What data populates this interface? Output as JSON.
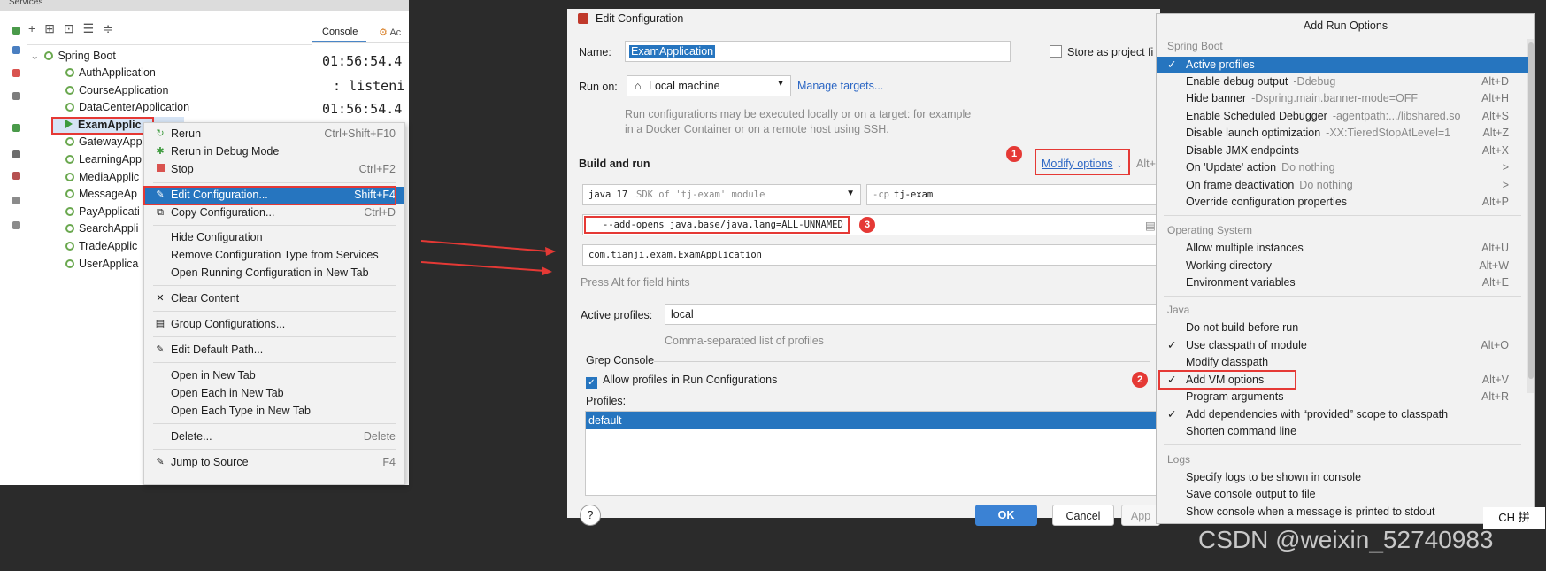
{
  "services": {
    "top_title": "Services",
    "toolbar_icons": [
      "add-icon",
      "group-icon",
      "new-tab-icon",
      "expand-all-icon",
      "collapse-all-icon"
    ],
    "tree_root": "Spring Boot",
    "apps": [
      "AuthApplication",
      "CourseApplication",
      "DataCenterApplication",
      "ExamApplic",
      "GatewayApp",
      "LearningApp",
      "MediaApplic",
      "MessageAp",
      "PayApplicati",
      "SearchAppli",
      "TradeApplic",
      "UserApplica"
    ],
    "console_tab": "Console",
    "console_tab2": "Ac",
    "console_lines": [
      "01:56:54.4",
      ": listeni",
      "01:56:54.4"
    ]
  },
  "context_menu": {
    "items": [
      {
        "label": "Rerun",
        "shortcut": "Ctrl+Shift+F10",
        "icon": "rerun-icon"
      },
      {
        "label": "Rerun in Debug Mode",
        "shortcut": "",
        "icon": "debug-icon"
      },
      {
        "label": "Stop",
        "shortcut": "Ctrl+F2",
        "icon": "stop-icon"
      },
      {
        "label": "Edit Configuration...",
        "shortcut": "Shift+F4",
        "icon": "edit-icon"
      },
      {
        "label": "Copy Configuration...",
        "shortcut": "Ctrl+D",
        "icon": "copy-icon"
      },
      {
        "label": "Hide Configuration",
        "shortcut": ""
      },
      {
        "label": "Remove Configuration Type from Services",
        "shortcut": ""
      },
      {
        "label": "Open Running Configuration in New Tab",
        "shortcut": ""
      },
      {
        "label": "Clear Content",
        "shortcut": "",
        "icon": "close-icon"
      },
      {
        "label": "Group Configurations...",
        "shortcut": "",
        "icon": "group-icon"
      },
      {
        "label": "Edit Default Path...",
        "shortcut": "",
        "icon": "edit-icon"
      },
      {
        "label": "Open in New Tab",
        "shortcut": ""
      },
      {
        "label": "Open Each in New Tab",
        "shortcut": ""
      },
      {
        "label": "Open Each Type in New Tab",
        "shortcut": ""
      },
      {
        "label": "Delete...",
        "shortcut": "Delete"
      },
      {
        "label": "Jump to Source",
        "shortcut": "F4",
        "icon": "jump-icon"
      }
    ]
  },
  "edit_config": {
    "title": "Edit Configuration",
    "name_label": "Name:",
    "name_value": "ExamApplication",
    "store_as_project": "Store as project fi",
    "run_on_label": "Run on:",
    "run_on_value": "Local machine",
    "manage_targets": "Manage targets...",
    "run_on_hint": "Run configurations may be executed locally or on a target: for example in a Docker Container or on a remote host using SSH.",
    "build_and_run": "Build and run",
    "modify_options": "Modify options",
    "modify_shortcut": "Alt+",
    "sdk_java": "java 17",
    "sdk_hint": "SDK of 'tj-exam' module",
    "cp_label": "-cp",
    "cp_value": "tj-exam",
    "vm_options": "--add-opens java.base/java.lang=ALL-UNNAMED",
    "main_class": "com.tianji.exam.ExamApplication",
    "alt_hint": "Press Alt for field hints",
    "active_profiles_label": "Active profiles:",
    "active_profiles_value": "local",
    "profiles_hint": "Comma-separated list of profiles",
    "grep_console": "Grep Console",
    "allow_profiles": "Allow profiles in Run Configurations",
    "profiles_label": "Profiles:",
    "profiles_list": [
      "default"
    ],
    "ok": "OK",
    "cancel": "Cancel",
    "apply": "App",
    "help": "?",
    "badges": [
      "1",
      "2",
      "3"
    ]
  },
  "add_run_options": {
    "title": "Add Run Options",
    "groups": [
      {
        "name": "Spring Boot",
        "items": [
          {
            "label": "Active profiles",
            "hint": "",
            "shortcut": "",
            "checked": true,
            "selected": true
          },
          {
            "label": "Enable debug output",
            "hint": "-Ddebug",
            "shortcut": "Alt+D"
          },
          {
            "label": "Hide banner",
            "hint": "-Dspring.main.banner-mode=OFF",
            "shortcut": "Alt+H"
          },
          {
            "label": "Enable Scheduled Debugger",
            "hint": "-agentpath:.../libshared.so",
            "shortcut": "Alt+S"
          },
          {
            "label": "Disable launch optimization",
            "hint": "-XX:TieredStopAtLevel=1",
            "shortcut": "Alt+Z"
          },
          {
            "label": "Disable JMX endpoints",
            "hint": "",
            "shortcut": "Alt+X"
          },
          {
            "label": "On 'Update' action",
            "hint": "Do nothing",
            "shortcut": ">"
          },
          {
            "label": "On frame deactivation",
            "hint": "Do nothing",
            "shortcut": ">"
          },
          {
            "label": "Override configuration properties",
            "hint": "",
            "shortcut": "Alt+P"
          }
        ]
      },
      {
        "name": "Operating System",
        "items": [
          {
            "label": "Allow multiple instances",
            "hint": "",
            "shortcut": "Alt+U"
          },
          {
            "label": "Working directory",
            "hint": "",
            "shortcut": "Alt+W"
          },
          {
            "label": "Environment variables",
            "hint": "",
            "shortcut": "Alt+E"
          }
        ]
      },
      {
        "name": "Java",
        "items": [
          {
            "label": "Do not build before run",
            "hint": "",
            "shortcut": ""
          },
          {
            "label": "Use classpath of module",
            "hint": "",
            "shortcut": "Alt+O",
            "checked": true
          },
          {
            "label": "Modify classpath",
            "hint": "",
            "shortcut": ""
          },
          {
            "label": "Add VM options",
            "hint": "",
            "shortcut": "Alt+V",
            "checked": true
          },
          {
            "label": "Program arguments",
            "hint": "",
            "shortcut": "Alt+R"
          },
          {
            "label": "Add dependencies with “provided” scope to classpath",
            "hint": "",
            "shortcut": "",
            "checked": true
          },
          {
            "label": "Shorten command line",
            "hint": "",
            "shortcut": ""
          }
        ]
      },
      {
        "name": "Logs",
        "items": [
          {
            "label": "Specify logs to be shown in console",
            "hint": "",
            "shortcut": ""
          },
          {
            "label": "Save console output to file",
            "hint": "",
            "shortcut": ""
          },
          {
            "label": "Show console when a message is printed to stdout",
            "hint": "",
            "shortcut": ""
          }
        ]
      }
    ]
  },
  "ime": "CH 拼",
  "watermark": "CSDN @weixin_52740983",
  "colors": {
    "selection": "#2675bf",
    "annotation_red": "#e53935",
    "link": "#2b66c4",
    "ok_button": "#3b82d4"
  }
}
